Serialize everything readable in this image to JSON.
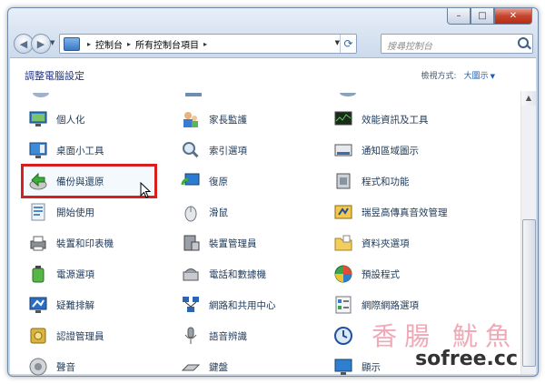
{
  "window": {
    "caption_buttons": {
      "minimize": "–",
      "maximize": "□",
      "close": "✕"
    }
  },
  "navigation": {
    "back_icon": "back-arrow-icon",
    "forward_icon": "forward-arrow-icon",
    "breadcrumbs": [
      "控制台",
      "所有控制台項目"
    ],
    "search_placeholder": "搜尋控制台"
  },
  "header": {
    "title": "調整電腦設定",
    "view_by_label": "檢視方式:",
    "view_by_value": "大圖示"
  },
  "items": {
    "col1": [
      "個人化",
      "桌面小工具",
      "備份與還原",
      "開始使用",
      "裝置和印表機",
      "電源選項",
      "疑難排解",
      "認證管理員",
      "聲音"
    ],
    "col2": [
      "家長監護",
      "索引選項",
      "復原",
      "滑鼠",
      "裝置管理員",
      "電話和數據機",
      "網路和共用中心",
      "語音辨識",
      "鍵盤"
    ],
    "col3": [
      "效能資訊及工具",
      "通知區域圖示",
      "程式和功能",
      "瑞昱高傳真音效管理",
      "資料夾選項",
      "預設程式",
      "網際網路選項",
      "",
      "顯示"
    ]
  },
  "highlighted_item": "備份與還原",
  "colors": {
    "highlight": "#d61f1f",
    "link_text": "#1e3a5a",
    "title": "#1e3287"
  },
  "watermark": {
    "line1": "香腸 魷魚",
    "line2": "sofree.cc"
  }
}
